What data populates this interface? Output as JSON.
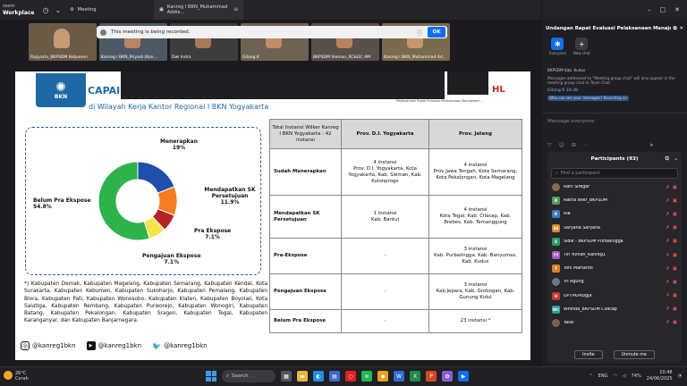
{
  "window": {
    "brand_line1": "zoom",
    "brand_line2": "Workplace",
    "tabs": [
      {
        "label": "Meeting"
      },
      {
        "label": "Kanreg I BKN_Muhammad Addie..."
      }
    ],
    "controls": [
      "–",
      "□",
      "✕"
    ]
  },
  "recording_banner": {
    "text": "This meeting is being recorded.",
    "info": "ⓘ",
    "ok_label": "OK"
  },
  "video_strip": {
    "tiles": [
      {
        "name": "Rajiyarto_BKPSDM Kebumen",
        "color": "#6b5a45",
        "face": "#c79a74"
      },
      {
        "name": "Kanreg I BKN_Priyadi (Kon...",
        "color": "#4d5a66",
        "face": "#b88562"
      },
      {
        "name": "Dwi Indra",
        "color": "#3d3d3d",
        "face": "#a7795a"
      },
      {
        "name": "Gilang K",
        "color": "#6e6252",
        "face": "#c48c65"
      },
      {
        "name": "BKPSDM Sleman_RC&DC AM",
        "color": "#58504a",
        "face": "#b7835e"
      },
      {
        "name": "Kanreg I BKN_Muhammad Ad...",
        "color": "#7a6a4e",
        "face": "#c9976c"
      }
    ]
  },
  "slide": {
    "logo_text": "BKN",
    "title_fragment": "CAPAI",
    "subtitle": "di Wilayah Kerja Kantor Regional I BKN Yogyakarta",
    "right_fragment": "HL",
    "right_fragment_sub": "Pelaksanaan Rapat Evaluasi Pelaksanaan Manajemen ...",
    "footnote": "*) Kabupaten Demak, Kabupaten Magelang, Kabupaten Semarang, Kabupaten Kendal, Kota Surakarta, Kabupaten Kebumen, Kabupaten Sukoharjo, Kabupaten Pemalang, Kabupaten Blora, Kabupaten Pati, Kabupaten Wonosobo, Kabupaten Klaten, Kabupaten Boyolali, Kota Salatiga, Kabupaten Rembang, Kabupaten Purworejo, Kabupaten Wonogiri, Kabupaten Batang, Kabupaten Pekalongan, Kabupaten Sragen, Kabupaten Tegal, Kabupaten Karanganyar, dan Kabupaten Banjarnegara.",
    "social": [
      {
        "icon": "instagram-icon",
        "glyph": "◎",
        "handle": "@kanreg1bkn"
      },
      {
        "icon": "youtube-icon",
        "glyph": "▶",
        "handle": "@kanreg1bkn"
      },
      {
        "icon": "twitter-icon",
        "glyph": "🐦",
        "handle": "@kanreg1bkn"
      }
    ],
    "table": {
      "headers": [
        "Total Instansi Wilker Kanreg I BKN Yogyakarta : 42 instansi",
        "Prov. D.I. Yogyakarta",
        "Prov. Jateng"
      ],
      "rows": [
        {
          "label": "Sudah Menerapkan",
          "diy": "4 instansi\nProv. D.I. Yogyakarta, Kota Yogyakarta, Kab. Sleman, Kab. Kulonprogo",
          "jateng": "4 instansi\nProv Jawa Tengah, Kota Semarang, Kota Pekalongan, Kota Magelang"
        },
        {
          "label": "Mendapatkan SK Persetujuan",
          "diy": "1 instansi\nKab. Bantul",
          "jateng": "4 instansi\nKota Tegal, Kab. Cilacap, Kab. Brebes, Kab. Temanggung"
        },
        {
          "label": "Pra-Ekspose",
          "diy": "-",
          "jateng": "3 instansi\nKab. Purbalingga, Kab. Banyumas, Kab. Kudus"
        },
        {
          "label": "Pengajuan Ekspose",
          "diy": "-",
          "jateng": "3 instansi\nKab.Jepara, Kab. Grobogan, Kab. Gunung Kidul"
        },
        {
          "label": "Belum Pra Ekspose",
          "diy": "-",
          "jateng": "23 instansi *"
        }
      ]
    }
  },
  "chart_data": {
    "type": "pie",
    "title": "",
    "categories": [
      "Menerapkan",
      "Mendapatkan SK Persetujuan",
      "Pra Ekspose",
      "Pengajuan Ekspose",
      "Belum Pra Ekspose"
    ],
    "values": [
      19,
      11.9,
      7.1,
      7.1,
      54.8
    ],
    "value_labels": [
      "19%",
      "11.9%",
      "7.1%",
      "7.1%",
      "54.8%"
    ],
    "colors": [
      "#1f4fa8",
      "#f57c20",
      "#b3232a",
      "#f2e44a",
      "#2eb24b"
    ],
    "donut": true
  },
  "side_panel": {
    "chat_title": "Undangan Rapat Evaluasi Pelaksanaan Manaje...",
    "chat_tabs": [
      {
        "label": "Everyone",
        "glyph": "✱"
      },
      {
        "label": "New chat",
        "glyph": "+"
      }
    ],
    "messages": [
      {
        "name": "",
        "text": "BKPSDM Kab. Kudus"
      },
      {
        "name": "",
        "text": "Messages addressed to \"Meeting group chat\" will also appear in the meeting group chat in Team Chat"
      },
      {
        "name": "Gilang K  10:38",
        "text": ""
      },
      {
        "name": "",
        "text": "Who can see your messages? Recording on"
      }
    ],
    "input_placeholder": "Message everyone",
    "tools": [
      "▽",
      "☺",
      "⊞",
      "⋯",
      "➤"
    ]
  },
  "participants": {
    "title": "Participants (93)",
    "search_placeholder": "Find a participant",
    "list": [
      {
        "initials": "img",
        "name": "Rani Siregar",
        "color": "#8a6a4a"
      },
      {
        "initials": "R",
        "name": "Ratna Wier_BKPSDM",
        "color": "#5a9a5a"
      },
      {
        "initials": "R",
        "name": "Ria",
        "color": "#3a7abf"
      },
      {
        "initials": "SS",
        "name": "Saryana Saryana",
        "color": "#d98a2a"
      },
      {
        "initials": "S",
        "name": "Sidik - BKPSDM Purbalingga",
        "color": "#2e9a6a"
      },
      {
        "initials": "TY",
        "name": "Tin Yuniati_Kanreg1",
        "color": "#a855c7"
      },
      {
        "initials": "T",
        "name": "Toni Martanto",
        "color": "#d9822a"
      },
      {
        "initials": "img",
        "name": "Tri Agung",
        "color": "#6a7a8a"
      },
      {
        "initials": "U",
        "name": "UPTPKPKogja",
        "color": "#c03a3a"
      },
      {
        "initials": "WC",
        "name": "Whinda_BKPSDM Cilacap",
        "color": "#2e9a9a"
      },
      {
        "initials": "img",
        "name": "Yassi",
        "color": "#7a6050"
      }
    ],
    "invite_label": "Invite",
    "unmute_label": "Unmute me"
  },
  "taskbar": {
    "temp": "26°C",
    "weather": "Cerah",
    "search_label": "Search",
    "lang": "ENG",
    "battery": "74%",
    "time": "10:48",
    "date": "24/06/2025"
  }
}
